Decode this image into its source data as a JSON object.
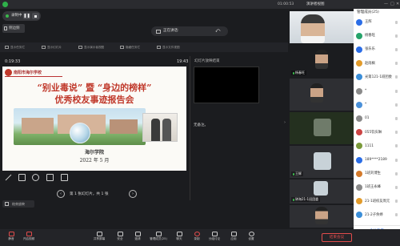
{
  "topbar": {
    "time": "01:00:53",
    "layout_label": "演讲者视图",
    "record_label": "管理成员(25)",
    "min_btn": "—",
    "max_btn": "□",
    "close_btn": "✕"
  },
  "recording": {
    "label": "录制中",
    "pause_symbol": "❚❚"
  },
  "mode": {
    "label": "侧边频"
  },
  "sharing": {
    "label": "正在讲话:",
    "back_symbol": "⤺"
  },
  "ppt_tools": [
    "显示任务栏",
    "显示幻灯片",
    "显示演示者视图",
    "隐藏任务栏",
    "显示文件视图"
  ],
  "ppt": {
    "timer": "0:19:33",
    "clock": "19:43",
    "side_header": "幻灯片放映结束",
    "notes": "无备注。",
    "slide": {
      "logo_text": "南阳市海尔学校",
      "title1": "“别业毒说”  暨  “身边的榜样”",
      "title2": "优秀校友事迹报告会",
      "school": "海尔学院",
      "date": "2022 年 5 月"
    },
    "pager_text": "第 1 张幻灯片，共 1 张",
    "prev": "‹",
    "next": "›",
    "end_show": "结束放映"
  },
  "video_tiles": [
    {
      "name": ""
    },
    {
      "name": "杨春旺"
    },
    {
      "name": ""
    },
    {
      "name": ""
    },
    {
      "name": "王辉"
    },
    {
      "name": "钟海21-1班团委"
    },
    {
      "name": ""
    }
  ],
  "participants": {
    "title": "管理成员(25)",
    "items": [
      {
        "name": "王辉",
        "color": "#2b6de6"
      },
      {
        "name": "杨春旺",
        "color": "#26a36a"
      },
      {
        "name": "张乐乐",
        "color": "#2b6de6"
      },
      {
        "name": "赵雨枫",
        "color": "#e29b2b"
      },
      {
        "name": "光第121-1班团委",
        "color": "#3b8ed8"
      },
      {
        "name": "*",
        "color": "#8a8a8a"
      },
      {
        "name": "*",
        "color": "#4a90d9"
      },
      {
        "name": "01",
        "color": "#8a8a8a"
      },
      {
        "name": "055钦庆琳",
        "color": "#c44"
      },
      {
        "name": "1111",
        "color": "#7a9a3a"
      },
      {
        "name": "189****2189",
        "color": "#2b6de6"
      },
      {
        "name": "1班刘博生",
        "color": "#d47a2b"
      },
      {
        "name": "1班王永峰",
        "color": "#8a8a8a"
      },
      {
        "name": "21-1班校友周元",
        "color": "#e29b2b"
      },
      {
        "name": "21-2子余婷",
        "color": "#3b8ed8"
      }
    ],
    "footer": "全体静音"
  },
  "bottom": {
    "buttons": [
      "静音",
      "开启视频",
      "共享屏幕",
      "安全",
      "邀请",
      "管理成员(25)",
      "聊天",
      "录制",
      "分组讨论",
      "应用",
      "设置"
    ],
    "leave": "结束会议"
  }
}
